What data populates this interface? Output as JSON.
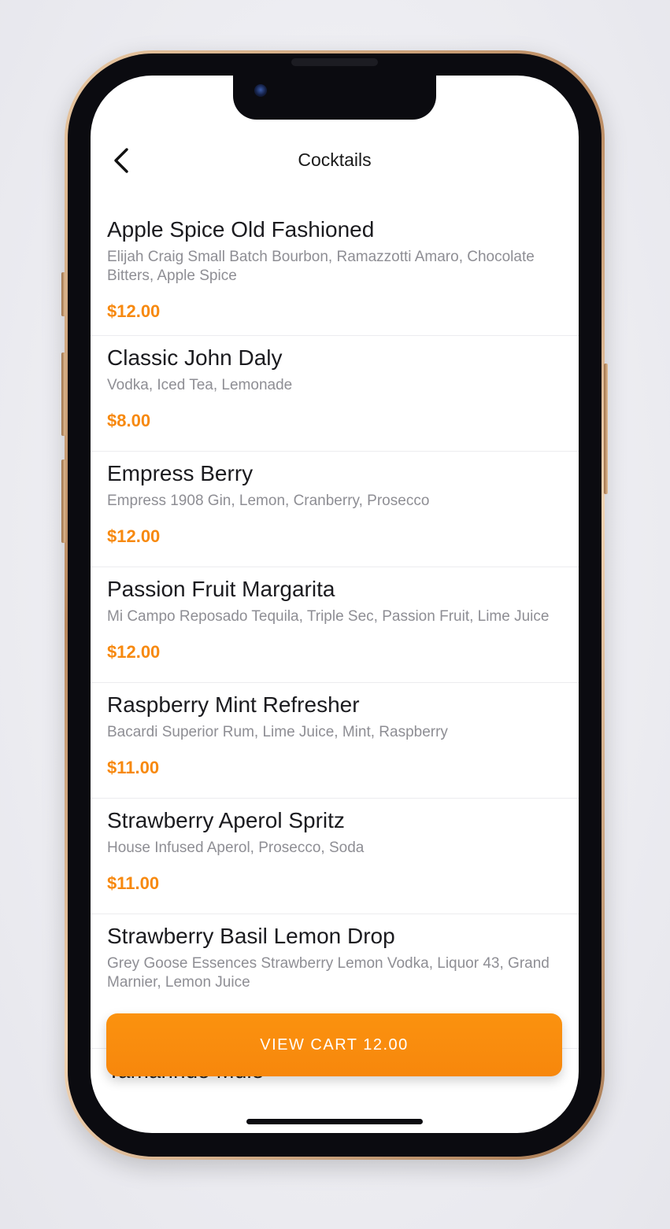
{
  "header": {
    "title": "Cocktails",
    "back_icon": "chevron-left-icon"
  },
  "menu": {
    "items": [
      {
        "name": "Apple Spice Old Fashioned",
        "description": "Elijah Craig Small Batch Bourbon, Ramazzotti Amaro, Chocolate Bitters, Apple Spice",
        "price": "$12.00"
      },
      {
        "name": "Classic John Daly",
        "description": "Vodka, Iced Tea, Lemonade",
        "price": "$8.00"
      },
      {
        "name": "Empress Berry",
        "description": "Empress 1908 Gin, Lemon, Cranberry, Prosecco",
        "price": "$12.00"
      },
      {
        "name": "Passion Fruit Margarita",
        "description": "Mi Campo Reposado Tequila, Triple Sec, Passion Fruit, Lime Juice",
        "price": "$12.00"
      },
      {
        "name": "Raspberry Mint Refresher",
        "description": "Bacardi Superior Rum, Lime Juice, Mint, Raspberry",
        "price": "$11.00"
      },
      {
        "name": "Strawberry Aperol Spritz",
        "description": "House Infused Aperol, Prosecco, Soda",
        "price": "$11.00"
      },
      {
        "name": "Strawberry Basil Lemon Drop",
        "description": "Grey Goose Essences Strawberry Lemon Vodka, Liquor 43, Grand Marnier, Lemon Juice",
        "price": ""
      },
      {
        "name": "Tamarindo Mule",
        "description": "",
        "price": ""
      }
    ]
  },
  "cart": {
    "label": "VIEW CART 12.00"
  },
  "colors": {
    "accent": "#f7890f",
    "text_primary": "#1b1b1f",
    "text_secondary": "#8e8e94",
    "background": "#ffffff"
  }
}
